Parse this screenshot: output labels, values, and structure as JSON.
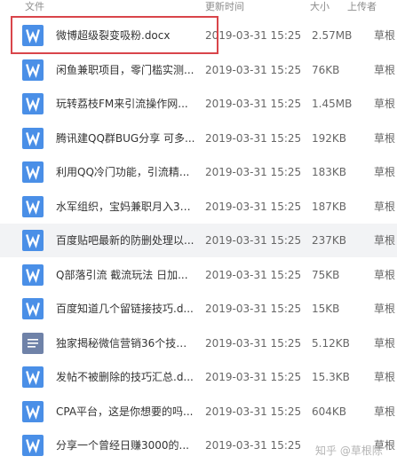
{
  "columns": {
    "name": "文件",
    "modified": "更新时间",
    "size": "大小",
    "uploader": "上传者"
  },
  "files": [
    {
      "name": "微博超级裂变吸粉.docx",
      "modified": "2019-03-31 15:25",
      "size": "2.57MB",
      "uploader": "草根",
      "icon": "word-doc-icon"
    },
    {
      "name": "闲鱼兼职项目，零门槛实测...",
      "modified": "2019-03-31 15:25",
      "size": "76KB",
      "uploader": "草根",
      "icon": "word-doc-icon"
    },
    {
      "name": "玩转荔枝FM来引流操作网...",
      "modified": "2019-03-31 15:25",
      "size": "1.45MB",
      "uploader": "草根",
      "icon": "word-doc-icon"
    },
    {
      "name": "腾讯建QQ群BUG分享 可多...",
      "modified": "2019-03-31 15:25",
      "size": "192KB",
      "uploader": "草根",
      "icon": "word-doc-icon"
    },
    {
      "name": "利用QQ冷门功能，引流精...",
      "modified": "2019-03-31 15:25",
      "size": "183KB",
      "uploader": "草根",
      "icon": "word-doc-icon"
    },
    {
      "name": "水军组织，宝妈兼职月入30...",
      "modified": "2019-03-31 15:25",
      "size": "187KB",
      "uploader": "草根",
      "icon": "word-doc-icon"
    },
    {
      "name": "百度贴吧最新的防删处理以...",
      "modified": "2019-03-31 15:25",
      "size": "237KB",
      "uploader": "草根",
      "icon": "word-doc-icon"
    },
    {
      "name": "Q部落引流 截流玩法 日加...",
      "modified": "2019-03-31 15:25",
      "size": "75KB",
      "uploader": "草根",
      "icon": "word-doc-icon"
    },
    {
      "name": "百度知道几个留链接技巧.d...",
      "modified": "2019-03-31 15:25",
      "size": "15KB",
      "uploader": "草根",
      "icon": "word-doc-icon"
    },
    {
      "name": "独家揭秘微信营销36个技巧...",
      "modified": "2019-03-31 15:25",
      "size": "5.12KB",
      "uploader": "草根",
      "icon": "text-file-icon"
    },
    {
      "name": "发帖不被删除的技巧汇总.d...",
      "modified": "2019-03-31 15:25",
      "size": "15.3KB",
      "uploader": "草根",
      "icon": "word-doc-icon"
    },
    {
      "name": "CPA平台，这是你想要的吗...",
      "modified": "2019-03-31 15:25",
      "size": "604KB",
      "uploader": "草根",
      "icon": "word-doc-icon"
    },
    {
      "name": "分享一个曾经日赚3000的...",
      "modified": "2019-03-31 15:25",
      "size": "",
      "uploader": "草根",
      "icon": "word-doc-icon"
    }
  ],
  "hovered_row": 6,
  "highlighted_row": 0,
  "colors": {
    "word_icon": "#4a8fe7",
    "text_icon": "#6f82a8",
    "highlight_border": "#d9454a",
    "hover_row": "#f2f3f5"
  },
  "watermark": "知乎 @草根陈"
}
